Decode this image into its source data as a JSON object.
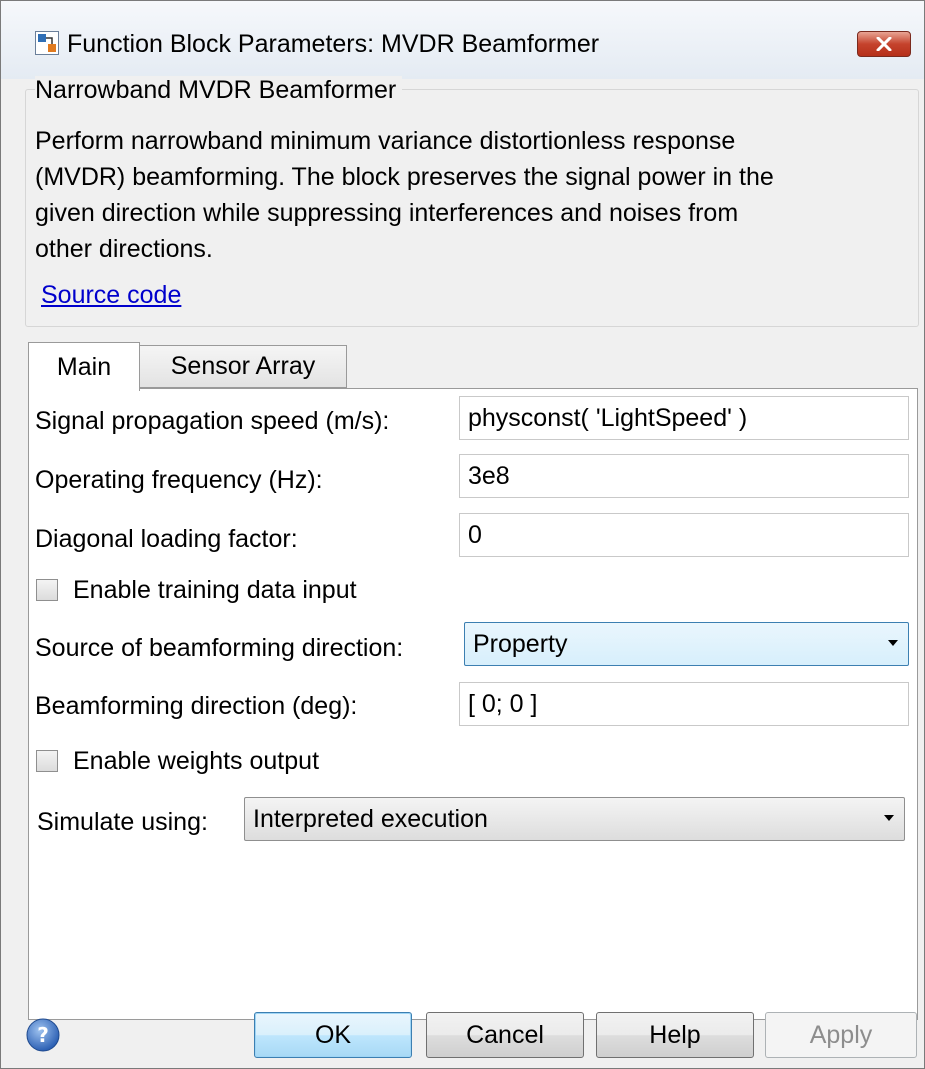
{
  "window": {
    "title": "Function Block Parameters: MVDR Beamformer"
  },
  "group": {
    "title": "Narrowband MVDR Beamformer",
    "description_lines": [
      "Perform narrowband minimum variance distortionless response",
      "(MVDR) beamforming. The block preserves the signal power in the",
      "given direction while suppressing interferences and noises from",
      "other directions."
    ],
    "source_link": "Source code"
  },
  "tabs": [
    {
      "label": "Main",
      "active": true
    },
    {
      "label": "Sensor Array",
      "active": false
    }
  ],
  "main": {
    "propagation_speed": {
      "label": "Signal propagation speed (m/s):",
      "value": "physconst( 'LightSpeed' )"
    },
    "operating_frequency": {
      "label": "Operating frequency (Hz):",
      "value": "3e8"
    },
    "diagonal_loading": {
      "label": "Diagonal loading factor:",
      "value": "0"
    },
    "enable_training": {
      "label": "Enable training data input",
      "checked": false
    },
    "source_direction": {
      "label": "Source of beamforming direction:",
      "value": "Property"
    },
    "beamforming_direction": {
      "label": "Beamforming direction (deg):",
      "value": "[ 0; 0 ]"
    },
    "enable_weights": {
      "label": "Enable weights output",
      "checked": false
    },
    "simulate_using": {
      "label": "Simulate using:",
      "value": "Interpreted execution"
    }
  },
  "buttons": {
    "ok": "OK",
    "cancel": "Cancel",
    "help": "Help",
    "apply": "Apply"
  },
  "icons": {
    "app": "simulink-block-icon",
    "close": "close-icon",
    "help": "help-icon"
  },
  "colors": {
    "link": "#0000cc",
    "close_button": "#c5432d",
    "focused_blue": "#3c7fb1"
  }
}
